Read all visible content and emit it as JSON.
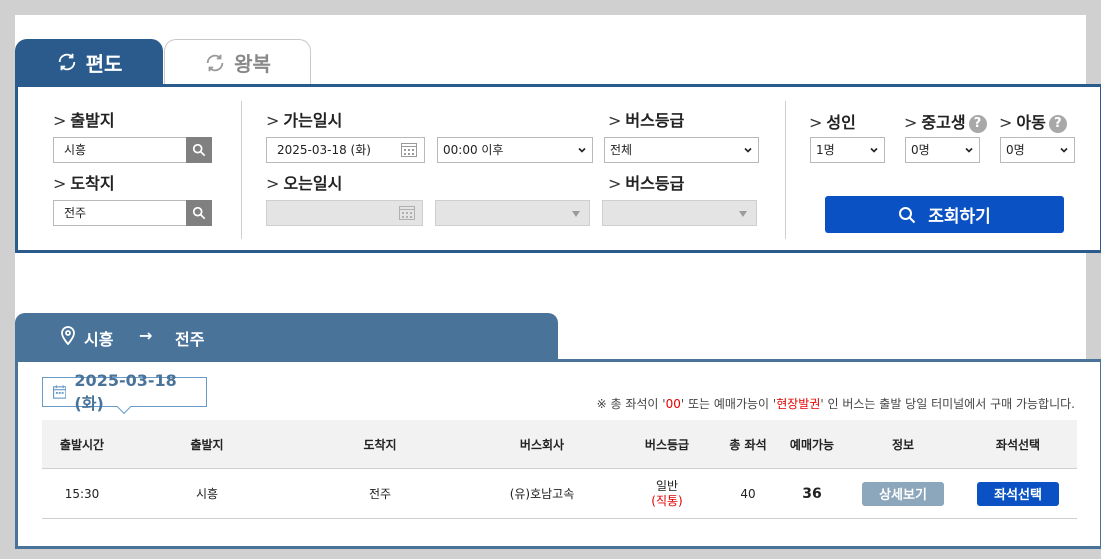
{
  "tabs": {
    "oneway": "편도",
    "roundtrip": "왕복"
  },
  "search": {
    "departure": {
      "label": "출발지",
      "value": "시흥"
    },
    "arrival": {
      "label": "도착지",
      "value": "전주"
    },
    "go_datetime": {
      "label": "가는일시",
      "date": "2025-03-18 (화)",
      "time": "00:00 이후"
    },
    "return_datetime": {
      "label": "오는일시",
      "date": "",
      "time": ""
    },
    "go_bus_grade": {
      "label": "버스등급",
      "value": "전체"
    },
    "return_bus_grade": {
      "label": "버스등급",
      "value": ""
    },
    "adult": {
      "label": "성인",
      "value": "1명"
    },
    "student": {
      "label": "중고생",
      "value": "0명",
      "help": "?"
    },
    "child": {
      "label": "아동",
      "value": "0명",
      "help": "?"
    },
    "submit_label": "조회하기"
  },
  "route": {
    "from": "시흥",
    "arrow": "→",
    "to": "전주"
  },
  "results": {
    "date": "2025-03-18 (화)",
    "notice": {
      "prefix": "※ 총 좌석이 '",
      "seat_code": "00",
      "mid": "' 또는 예매가능이 '",
      "onsite": "현장발권",
      "suffix": "' 인 버스는 출발 당일 터미널에서 구매 가능합니다."
    },
    "columns": [
      "출발시간",
      "출발지",
      "도착지",
      "버스회사",
      "버스등급",
      "총 좌석",
      "예매가능",
      "정보",
      "좌석선택"
    ],
    "rows": [
      {
        "time": "15:30",
        "departure": "시흥",
        "arrival": "전주",
        "company": "(유)호남고속",
        "grade": "일반",
        "grade_note": "(직통)",
        "total_seats": "40",
        "available": "36",
        "detail_label": "상세보기",
        "seat_label": "좌석선택"
      }
    ]
  },
  "colors": {
    "tab_active": "#2a5b8c",
    "result_accent": "#4a7399",
    "primary_button": "#0a52c4",
    "detail_button": "#8ca6bc",
    "notice_highlight": "#e60000"
  }
}
